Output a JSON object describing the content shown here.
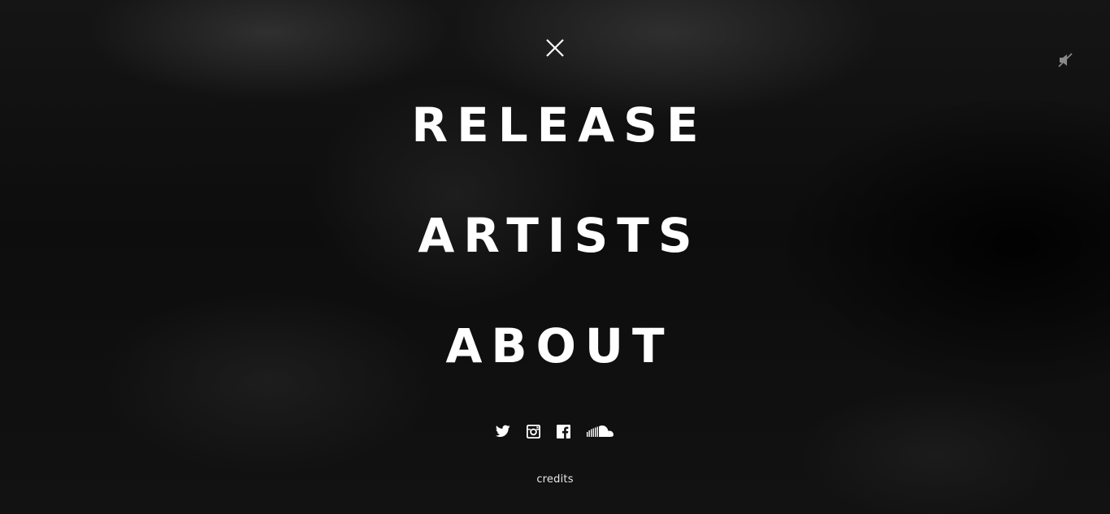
{
  "overlay_menu": {
    "close_icon": "close-icon",
    "mute_icon": "speaker-muted-icon",
    "items": [
      {
        "label": "RELEASE"
      },
      {
        "label": "ARTISTS"
      },
      {
        "label": "ABOUT"
      }
    ],
    "socials": [
      {
        "icon": "twitter-icon"
      },
      {
        "icon": "instagram-icon"
      },
      {
        "icon": "facebook-icon"
      },
      {
        "icon": "soundcloud-icon"
      }
    ],
    "credits_label": "credits"
  },
  "colors": {
    "text": "#ffffff",
    "background": "#0a0a0a",
    "muted_icon": "#8a8a8a"
  }
}
